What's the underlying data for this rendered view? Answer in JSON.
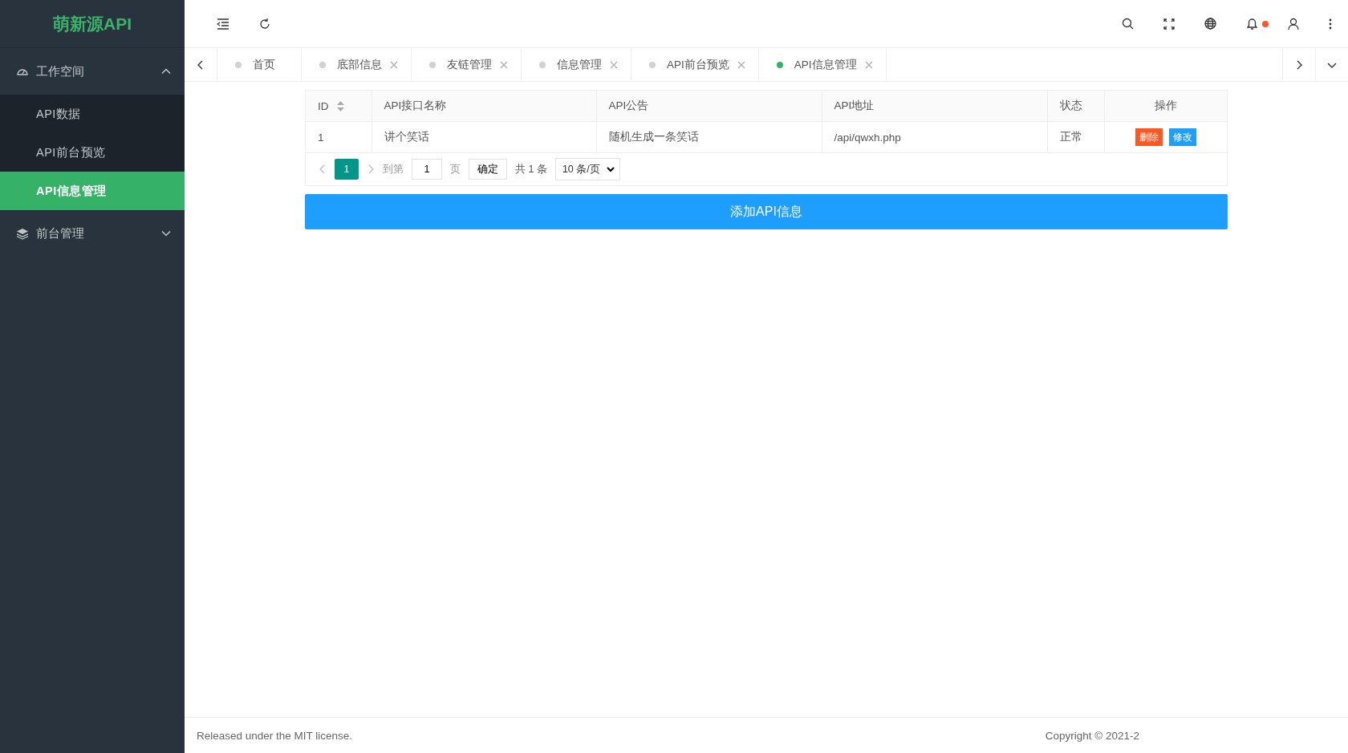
{
  "sidebar": {
    "logo": "萌新源API",
    "menu": [
      {
        "label": "工作空间",
        "expanded": true,
        "children": [
          {
            "label": "API数据",
            "selected": false
          },
          {
            "label": "API前台预览",
            "selected": false
          },
          {
            "label": "API信息管理",
            "selected": true
          }
        ]
      },
      {
        "label": "前台管理",
        "expanded": false
      }
    ]
  },
  "header": {
    "notification_dot": true
  },
  "tabs": [
    {
      "label": "首页",
      "selected": false,
      "closable": false
    },
    {
      "label": "底部信息",
      "selected": false,
      "closable": true
    },
    {
      "label": "友链管理",
      "selected": false,
      "closable": true
    },
    {
      "label": "信息管理",
      "selected": false,
      "closable": true
    },
    {
      "label": "API前台预览",
      "selected": false,
      "closable": true
    },
    {
      "label": "API信息管理",
      "selected": true,
      "closable": true
    }
  ],
  "table": {
    "columns": [
      {
        "label": "ID",
        "sortable": true
      },
      {
        "label": "API接口名称",
        "sortable": false
      },
      {
        "label": "API公告",
        "sortable": false
      },
      {
        "label": "API地址",
        "sortable": false
      },
      {
        "label": "状态",
        "sortable": false
      },
      {
        "label": "操作",
        "sortable": false
      }
    ],
    "rows": [
      {
        "cells": [
          "1",
          "讲个笑话",
          "随机生成一条笑话",
          "/api/qwxh.php",
          "正常"
        ],
        "actions": [
          {
            "label": "删除",
            "kind": "danger"
          },
          {
            "label": "修改",
            "kind": "normal"
          }
        ]
      }
    ],
    "pagination": {
      "pages": [
        {
          "label": "1",
          "selected": true
        }
      ],
      "goto_label": "到第",
      "goto_value": "1",
      "page_unit": "页",
      "confirm": "确定",
      "total": "共 1 条",
      "page_size": "10 条/页"
    }
  },
  "add_button": "添加API信息",
  "footer": {
    "left": "Released under the MIT license.",
    "right": "Copyright © 2021-2"
  }
}
